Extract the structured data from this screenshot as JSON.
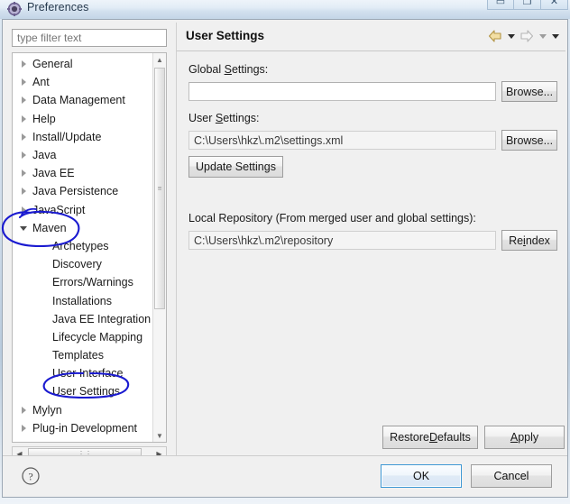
{
  "window": {
    "title": "Preferences",
    "icon": "preferences-gear-icon",
    "controls": [
      {
        "name": "minimize",
        "glyph": "▭"
      },
      {
        "name": "maximize",
        "glyph": "❐"
      },
      {
        "name": "close",
        "glyph": "✕"
      }
    ]
  },
  "sidebar": {
    "filter": {
      "value": "",
      "placeholder": "type filter text"
    },
    "items": [
      {
        "label": "General",
        "indent": 0,
        "twisty": "collapsed"
      },
      {
        "label": "Ant",
        "indent": 0,
        "twisty": "collapsed"
      },
      {
        "label": "Data Management",
        "indent": 0,
        "twisty": "collapsed"
      },
      {
        "label": "Help",
        "indent": 0,
        "twisty": "collapsed"
      },
      {
        "label": "Install/Update",
        "indent": 0,
        "twisty": "collapsed"
      },
      {
        "label": "Java",
        "indent": 0,
        "twisty": "collapsed"
      },
      {
        "label": "Java EE",
        "indent": 0,
        "twisty": "collapsed"
      },
      {
        "label": "Java Persistence",
        "indent": 0,
        "twisty": "collapsed"
      },
      {
        "label": "JavaScript",
        "indent": 0,
        "twisty": "collapsed"
      },
      {
        "label": "Maven",
        "indent": 0,
        "twisty": "expanded"
      },
      {
        "label": "Archetypes",
        "indent": 1,
        "twisty": "none"
      },
      {
        "label": "Discovery",
        "indent": 1,
        "twisty": "none"
      },
      {
        "label": "Errors/Warnings",
        "indent": 1,
        "twisty": "none"
      },
      {
        "label": "Installations",
        "indent": 1,
        "twisty": "none"
      },
      {
        "label": "Java EE Integration",
        "indent": 1,
        "twisty": "none"
      },
      {
        "label": "Lifecycle Mapping",
        "indent": 1,
        "twisty": "none"
      },
      {
        "label": "Templates",
        "indent": 1,
        "twisty": "none"
      },
      {
        "label": "User Interface",
        "indent": 1,
        "twisty": "none"
      },
      {
        "label": "User Settings",
        "indent": 1,
        "twisty": "none"
      },
      {
        "label": "Mylyn",
        "indent": 0,
        "twisty": "collapsed"
      },
      {
        "label": "Plug-in Development",
        "indent": 0,
        "twisty": "collapsed"
      }
    ],
    "scroll": {
      "grip": "≡",
      "up": "▲",
      "down": "▼",
      "left": "◀",
      "right": "▶",
      "hgrip": "⋮⋮"
    }
  },
  "content": {
    "title": "User Settings",
    "nav": {
      "back_icon": "back-arrow-icon",
      "back_caret": "▼",
      "forward_icon": "forward-arrow-icon",
      "forward_caret": "▼",
      "menu_caret": "▼"
    },
    "global_settings": {
      "label_pre": "Global ",
      "label_key": "S",
      "label_post": "ettings:",
      "value": "",
      "browse_label": "Browse..."
    },
    "user_settings": {
      "label_pre": "User ",
      "label_key": "S",
      "label_post": "ettings:",
      "value": "C:\\Users\\hkz\\.m2\\settings.xml",
      "browse_label": "Browse...",
      "update_label": "Update Settings"
    },
    "local_repository": {
      "label": "Local Repository (From merged user and global settings):",
      "value": "C:\\Users\\hkz\\.m2\\repository",
      "reindex_pre": "Re",
      "reindex_key": "i",
      "reindex_post": "ndex"
    },
    "restore_defaults": {
      "pre": "Restore ",
      "key": "D",
      "post": "efaults"
    },
    "apply": {
      "pre": "",
      "key": "A",
      "post": "pply"
    }
  },
  "footer": {
    "help_icon": "help-question-icon",
    "ok_label": "OK",
    "cancel_label": "Cancel"
  },
  "annotations": {
    "ink_color": "#1a1ad0",
    "marks": [
      {
        "name": "maven-circle",
        "target": "Maven"
      },
      {
        "name": "user-settings-circle",
        "target": "User Settings"
      }
    ]
  }
}
